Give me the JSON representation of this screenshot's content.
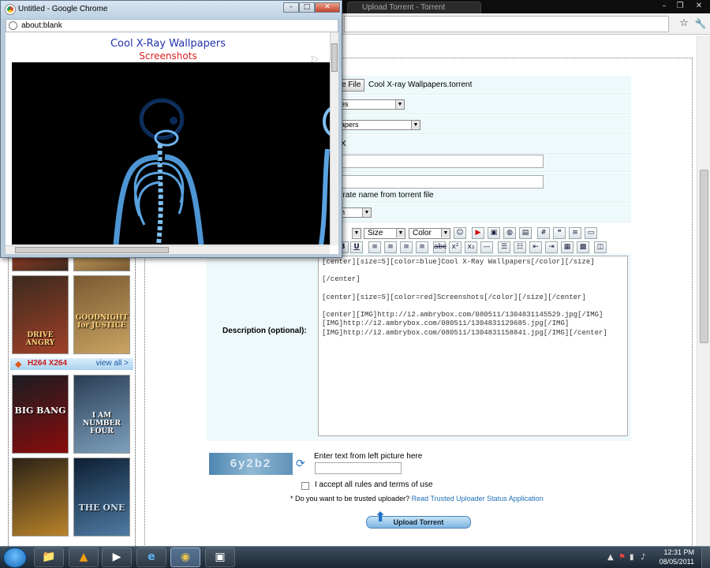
{
  "background_window": {
    "tab_title": "Upload Torrent - Torrent",
    "window_controls": [
      "–",
      "❐",
      "✕"
    ],
    "star_icon": "☆",
    "wrench_icon": "🔧"
  },
  "sidebar": {
    "category_title": "H264 X264",
    "view_all": "view all >",
    "posters": [
      {
        "title": "DRIVE ANGRY",
        "colors": [
          "#3b2a1e",
          "#a04028"
        ]
      },
      {
        "title": "GOODNIGHT for JUSTICE",
        "colors": [
          "#7a5a32",
          "#c9a463"
        ]
      },
      {
        "title": "BIG BANG",
        "colors": [
          "#1a1d22",
          "#8a0c0c"
        ]
      },
      {
        "title": "I AM NUMBER FOUR",
        "colors": [
          "#2a3e55",
          "#7ea0bd"
        ]
      },
      {
        "title": "",
        "colors": [
          "#2b2216",
          "#b9832a"
        ]
      },
      {
        "title": "THE ONE",
        "colors": [
          "#0d1f33",
          "#4f7ba3"
        ]
      }
    ]
  },
  "form": {
    "choose_file_button": "e File",
    "file_name": "Cool X-ray Wallpapers.torrent",
    "category_select": "es",
    "subcategory_select": "apers",
    "x_text": "X",
    "generate_name_label": "erate name from torrent file",
    "language_select": "h",
    "editor": {
      "size_label": "Size",
      "color_label": "Color",
      "bold": "B",
      "underline": "U"
    },
    "description_label": "Description (optional):",
    "description_text": "[center][size=5][color=blue]Cool X-Ray Wallpapers[/color][/size]\n\n[/center]\n\n[center][size=5][color=red]Screenshots[/color][/size][/center]\n\n[center][IMG]http://i2.ambrybox.com/080511/1304831145529.jpg[/IMG]\n[IMG]http://i2.ambrybox.com/080511/1304831129685.jpg[/IMG]\n[IMG]http://i2.ambrybox.com/080511/1304831158841.jpg[/IMG][/center]",
    "captcha_label": "Enter text from left picture here",
    "captcha_text": "6y2b2",
    "accept_label": "I accept all rules and terms of use",
    "trusted_question": "* Do you want to be trusted uploader?",
    "trusted_link": "Read Trusted Uploader Status Application",
    "upload_button": "Upload Torrent"
  },
  "popup": {
    "title": "Untitled - Google Chrome",
    "address": "about:blank",
    "preview_title": "Cool X-Ray Wallpapers",
    "preview_subtitle": "Screenshots",
    "buttons": [
      "–",
      "□",
      "✕"
    ]
  },
  "taskbar": {
    "apps": [
      "📁",
      "▲",
      "▶",
      "e",
      "◉",
      "▣"
    ],
    "time": "12:31 PM",
    "date": "08/05/2011"
  }
}
